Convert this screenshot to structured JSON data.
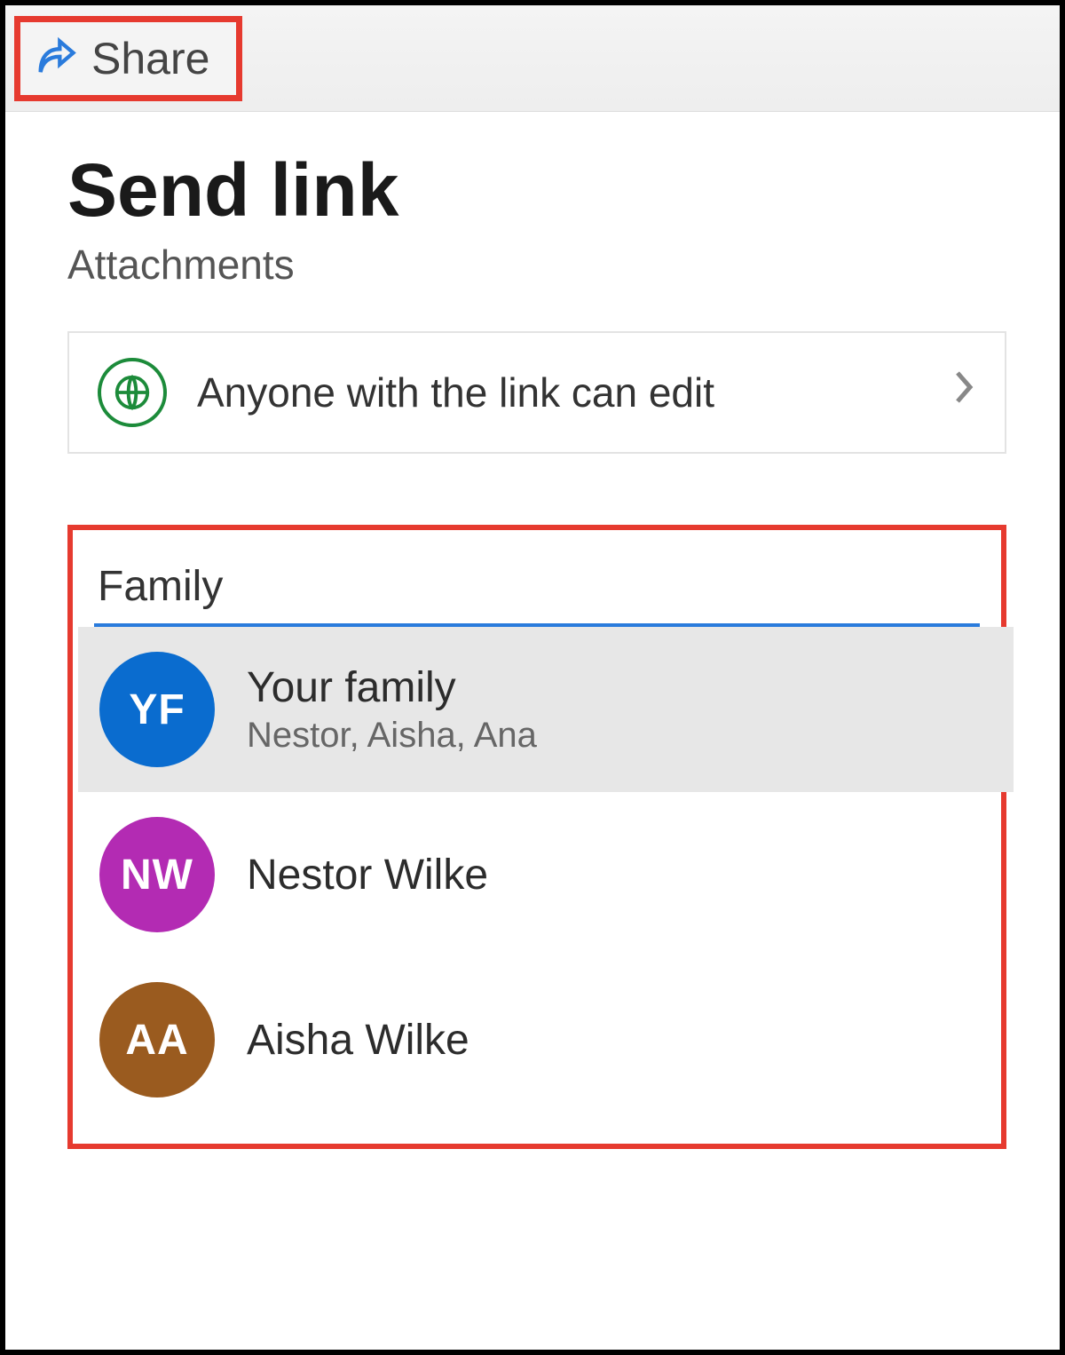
{
  "toolbar": {
    "share_label": "Share"
  },
  "dialog": {
    "title": "Send link",
    "subtitle": "Attachments",
    "permission_label": "Anyone with the link can edit"
  },
  "search": {
    "value": "Family"
  },
  "suggestions": [
    {
      "initials": "YF",
      "name": "Your family",
      "sub": "Nestor, Aisha, Ana",
      "avatar_color": "blue",
      "highlight": true
    },
    {
      "initials": "NW",
      "name": "Nestor Wilke",
      "sub": "",
      "avatar_color": "purple",
      "highlight": false
    },
    {
      "initials": "AA",
      "name": "Aisha Wilke",
      "sub": "",
      "avatar_color": "brown",
      "highlight": false
    }
  ]
}
